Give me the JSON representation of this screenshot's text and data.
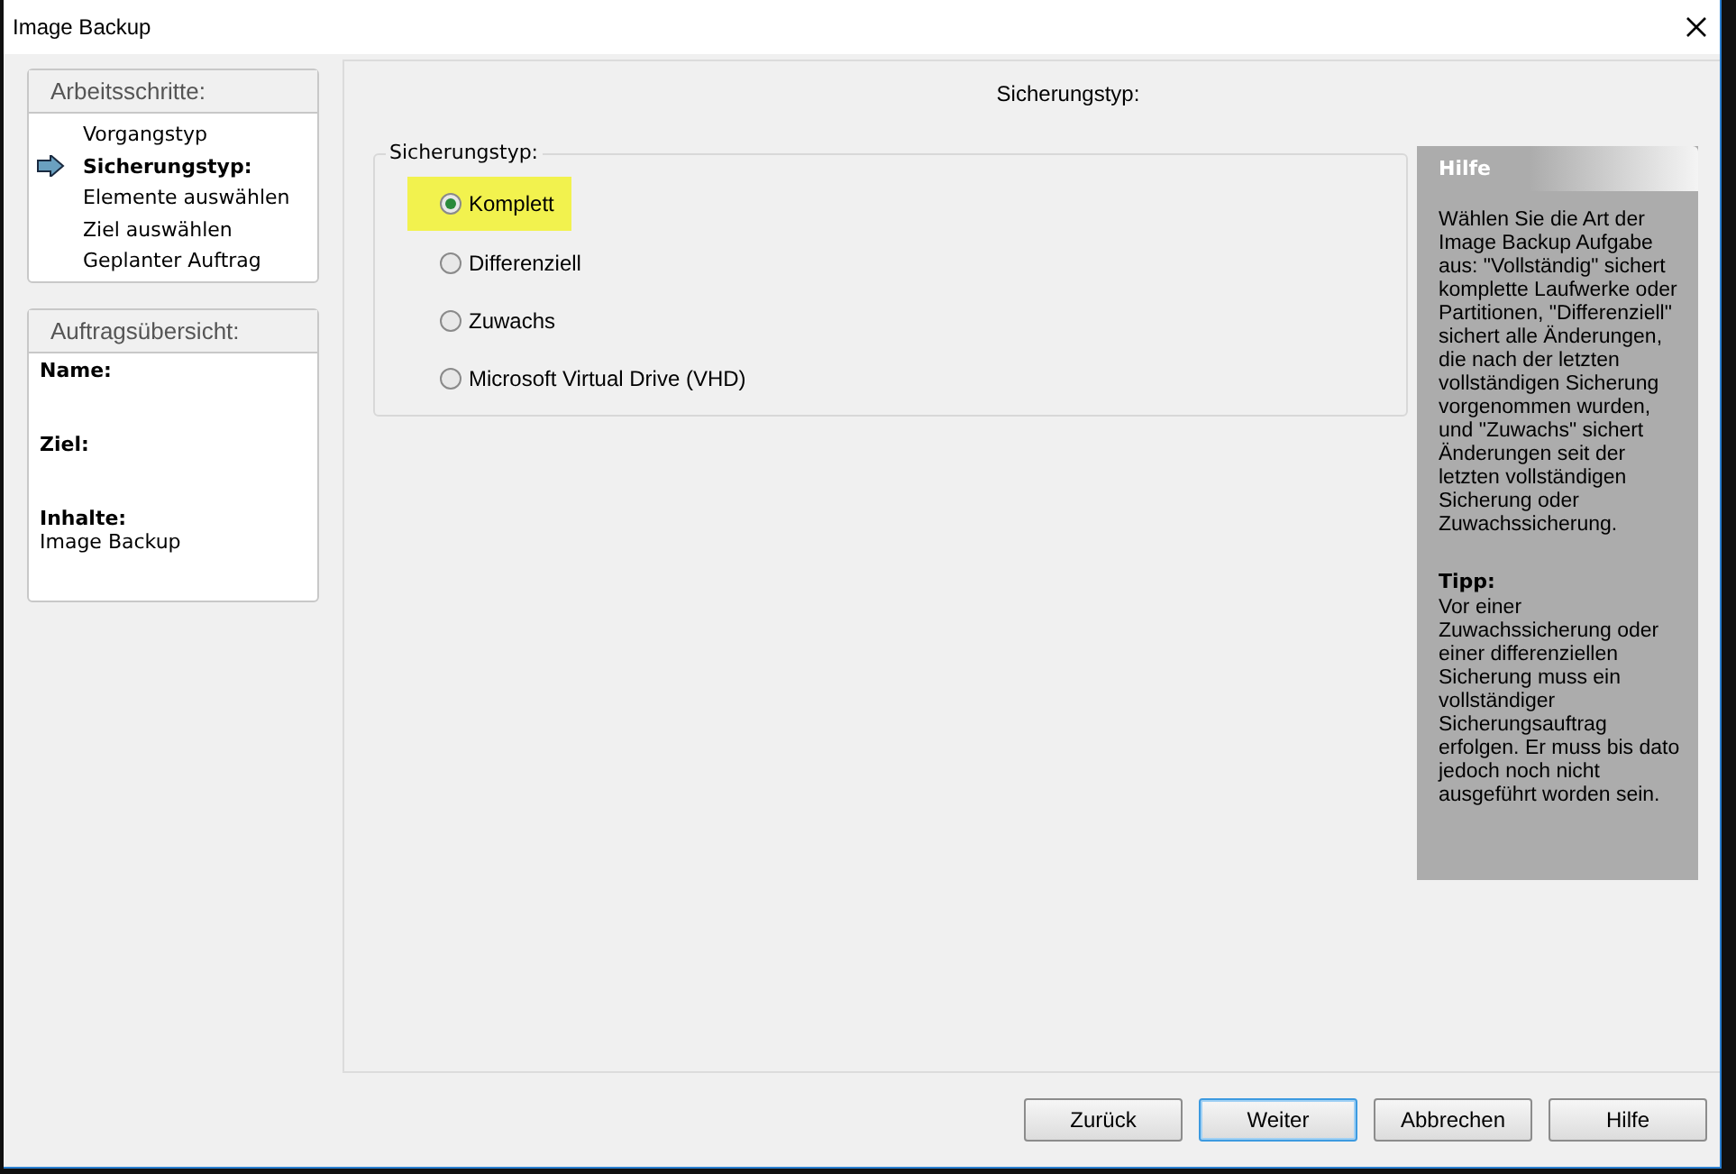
{
  "window": {
    "title": "Image Backup"
  },
  "steps": {
    "title": "Arbeitsschritte:",
    "items": [
      {
        "label": "Vorgangstyp",
        "selected": false
      },
      {
        "label": "Sicherungstyp:",
        "selected": true
      },
      {
        "label": "Elemente auswählen",
        "selected": false
      },
      {
        "label": "Ziel auswählen",
        "selected": false
      },
      {
        "label": "Geplanter Auftrag",
        "selected": false
      }
    ]
  },
  "summary": {
    "title": "Auftragsübersicht:",
    "fields": [
      {
        "label": "Name:"
      },
      {
        "label": "Ziel:"
      },
      {
        "label": "Inhalte:",
        "value": "Image Backup"
      }
    ]
  },
  "main": {
    "heading": "Sicherungstyp:",
    "group": {
      "legend": "Sicherungstyp:",
      "options": [
        {
          "label": "Komplett",
          "selected": true
        },
        {
          "label": "Differenziell",
          "selected": false
        },
        {
          "label": "Zuwachs",
          "selected": false
        },
        {
          "label": "Microsoft Virtual Drive (VHD)",
          "selected": false
        }
      ]
    }
  },
  "help": {
    "title": "Hilfe",
    "text": "Wählen Sie die Art der Image Backup Aufgabe aus: \"Vollständig\" sichert komplette Laufwerke oder Partitionen, \"Differenziell\" sichert alle Änderungen, die nach der letzten vollständigen Sicherung vorgenommen wurden, und \"Zuwachs\" sichert Änderungen seit der letzten vollständigen Sicherung oder Zuwachssicherung.",
    "tip_title": "Tipp:",
    "tip_text": "Vor einer Zuwachssicherung oder einer differenziellen Sicherung muss ein vollständiger Sicherungsauftrag erfolgen. Er muss bis dato jedoch noch nicht ausgeführt worden sein."
  },
  "buttons": [
    {
      "label": "Zurück",
      "default": false
    },
    {
      "label": "Weiter",
      "default": true
    },
    {
      "label": "Abbrechen",
      "default": false
    },
    {
      "label": "Hilfe",
      "default": false
    }
  ]
}
